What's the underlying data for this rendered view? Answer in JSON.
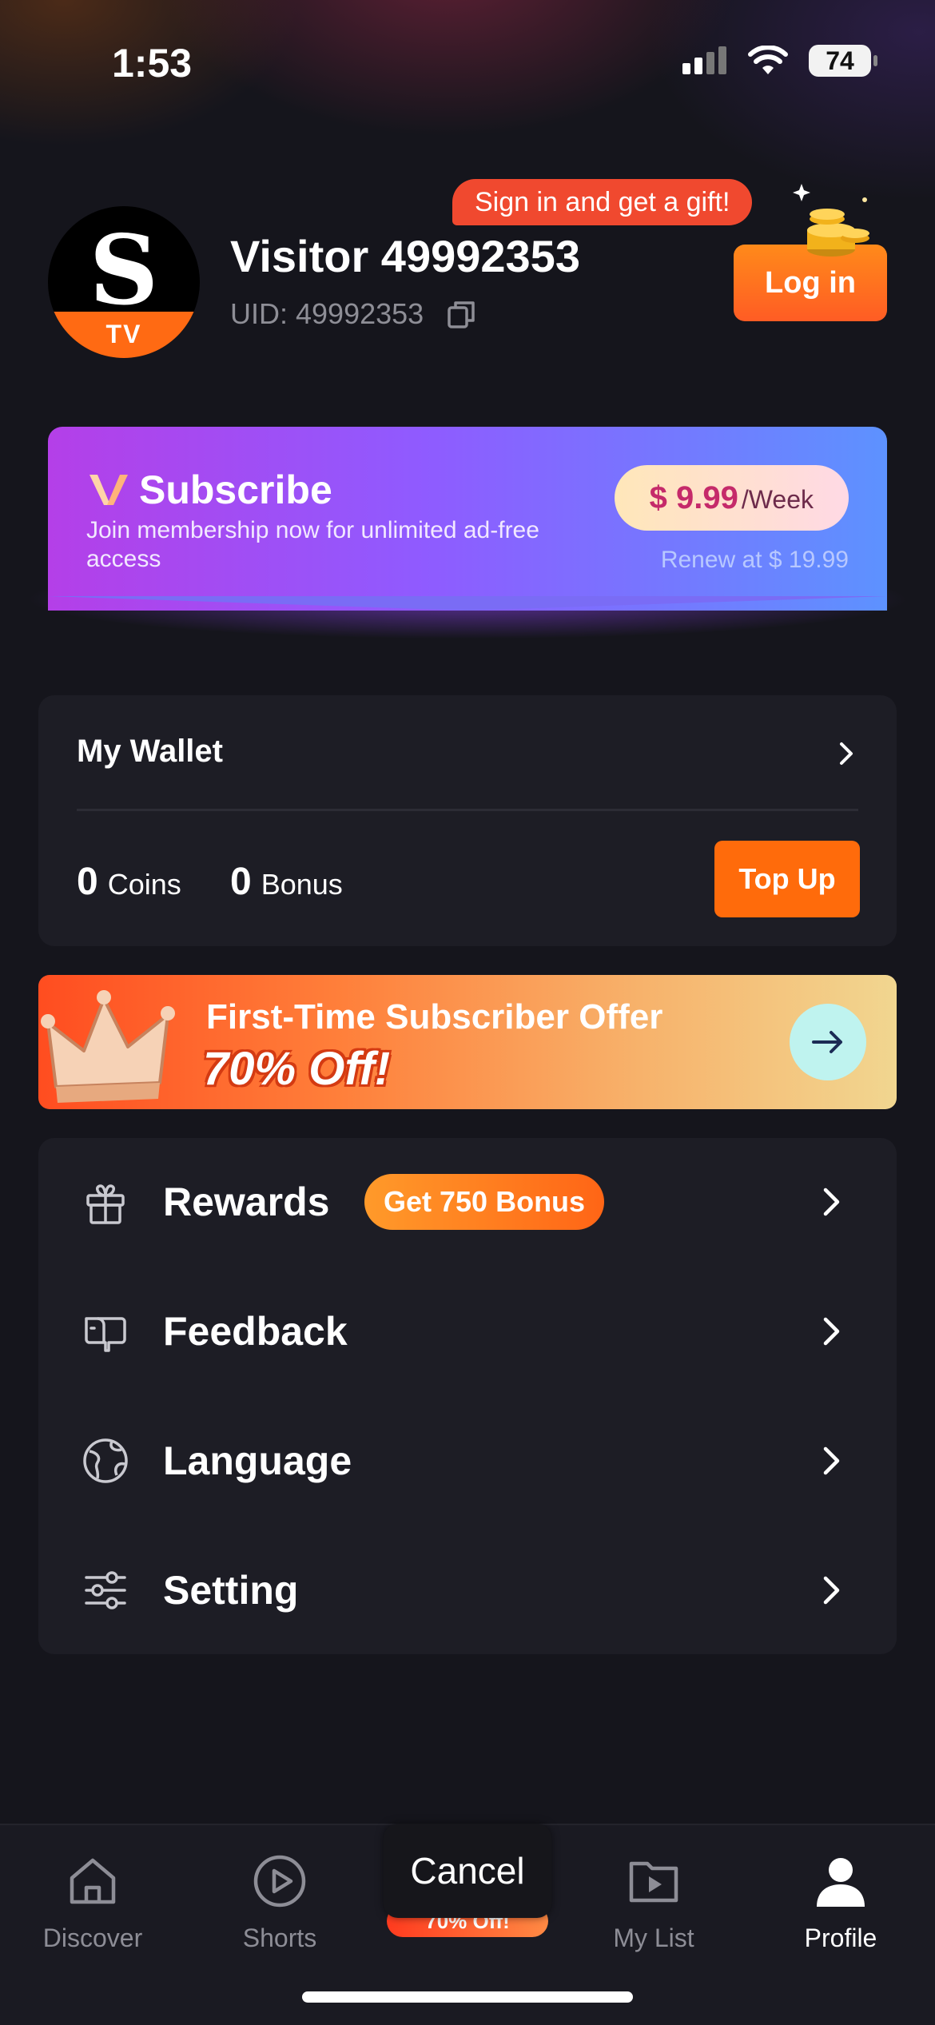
{
  "status_bar": {
    "time": "1:53",
    "battery": "74"
  },
  "profile": {
    "avatar_letter": "S",
    "avatar_badge": "TV",
    "name": "Visitor 49992353",
    "uid": "UID: 49992353",
    "gift_tip": "Sign in and get a gift!",
    "login_label": "Log in"
  },
  "subscribe": {
    "title": "Subscribe",
    "description": "Join membership now for unlimited ad-free access",
    "price": "$ 9.99",
    "period": "/Week",
    "renew": "Renew at $ 19.99"
  },
  "wallet": {
    "title": "My Wallet",
    "coins_value": "0",
    "coins_label": "Coins",
    "bonus_value": "0",
    "bonus_label": "Bonus",
    "topup_label": "Top Up"
  },
  "offer": {
    "title": "First-Time Subscriber Offer",
    "discount": "70% Off!"
  },
  "menu": {
    "items": [
      {
        "label": "Rewards",
        "badge": "Get 750 Bonus",
        "icon": "gift-icon"
      },
      {
        "label": "Feedback",
        "icon": "feedback-icon"
      },
      {
        "label": "Language",
        "icon": "globe-icon"
      },
      {
        "label": "Setting",
        "icon": "sliders-icon"
      }
    ]
  },
  "tabbar": {
    "tabs": [
      {
        "label": "Discover",
        "icon": "home-icon"
      },
      {
        "label": "Shorts",
        "icon": "play-circle-icon"
      },
      {
        "label": "My List",
        "icon": "folder-play-icon"
      },
      {
        "label": "Profile",
        "icon": "person-icon",
        "active": true
      }
    ],
    "cancel_label": "Cancel",
    "promo_label": "70% Off!"
  },
  "colors": {
    "accent_orange": "#ff6b0b",
    "background": "#15151c",
    "card": "#1d1d25",
    "subscribe_gradient_start": "#b43fe8",
    "subscribe_gradient_end": "#5d92ff"
  }
}
